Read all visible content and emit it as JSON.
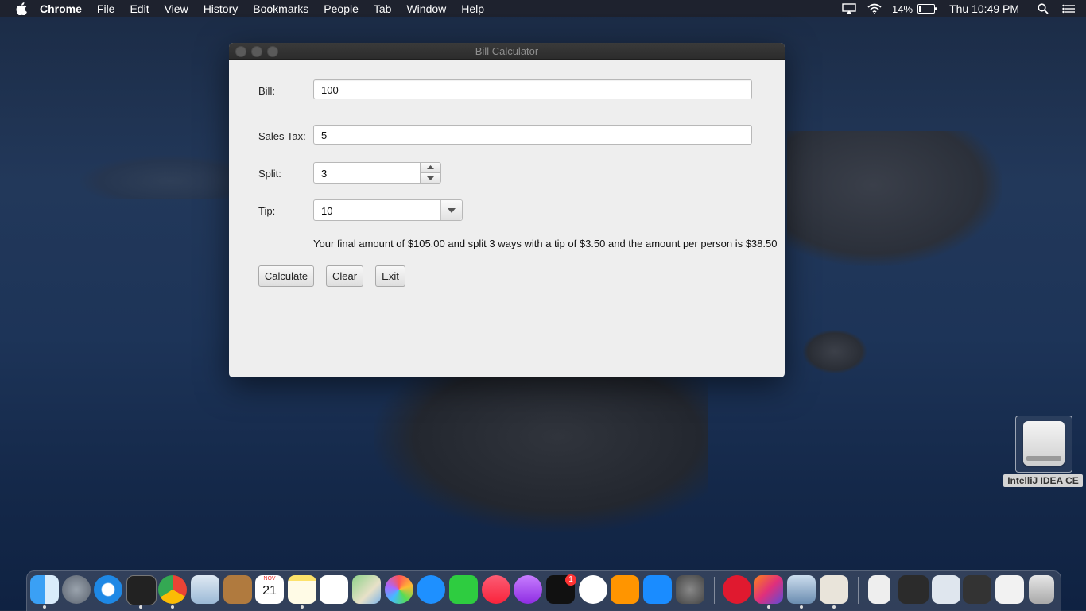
{
  "menubar": {
    "app_name": "Chrome",
    "items": [
      "File",
      "Edit",
      "View",
      "History",
      "Bookmarks",
      "People",
      "Tab",
      "Window",
      "Help"
    ],
    "battery_percent": "14%",
    "clock": "Thu 10:49 PM"
  },
  "window": {
    "title": "Bill Calculator",
    "bill_label": "Bill:",
    "bill_value": "100",
    "tax_label": "Sales Tax:",
    "tax_value": "5",
    "split_label": "Split:",
    "split_value": "3",
    "tip_label": "Tip:",
    "tip_value": "10",
    "result_text": "Your final amount of $105.00 and split 3 ways with a tip of $3.50 and the amount per person is $38.50",
    "calculate_label": "Calculate",
    "clear_label": "Clear",
    "exit_label": "Exit"
  },
  "desktop": {
    "drive_label": "IntelliJ IDEA CE"
  },
  "dock": {
    "apps": [
      "Finder",
      "Launchpad",
      "Safari",
      "Terminal",
      "Chrome",
      "Mail",
      "Contacts",
      "Calendar",
      "Notes",
      "Reminders",
      "Maps",
      "Photos",
      "Messages",
      "FaceTime",
      "Music",
      "Podcasts",
      "TV",
      "News",
      "Books",
      "App Store",
      "System Preferences",
      "Pocket",
      "IntelliJ IDEA",
      "Preview",
      "Java"
    ],
    "calendar_month": "NOV",
    "calendar_day": "21",
    "tv_badge": "1"
  }
}
